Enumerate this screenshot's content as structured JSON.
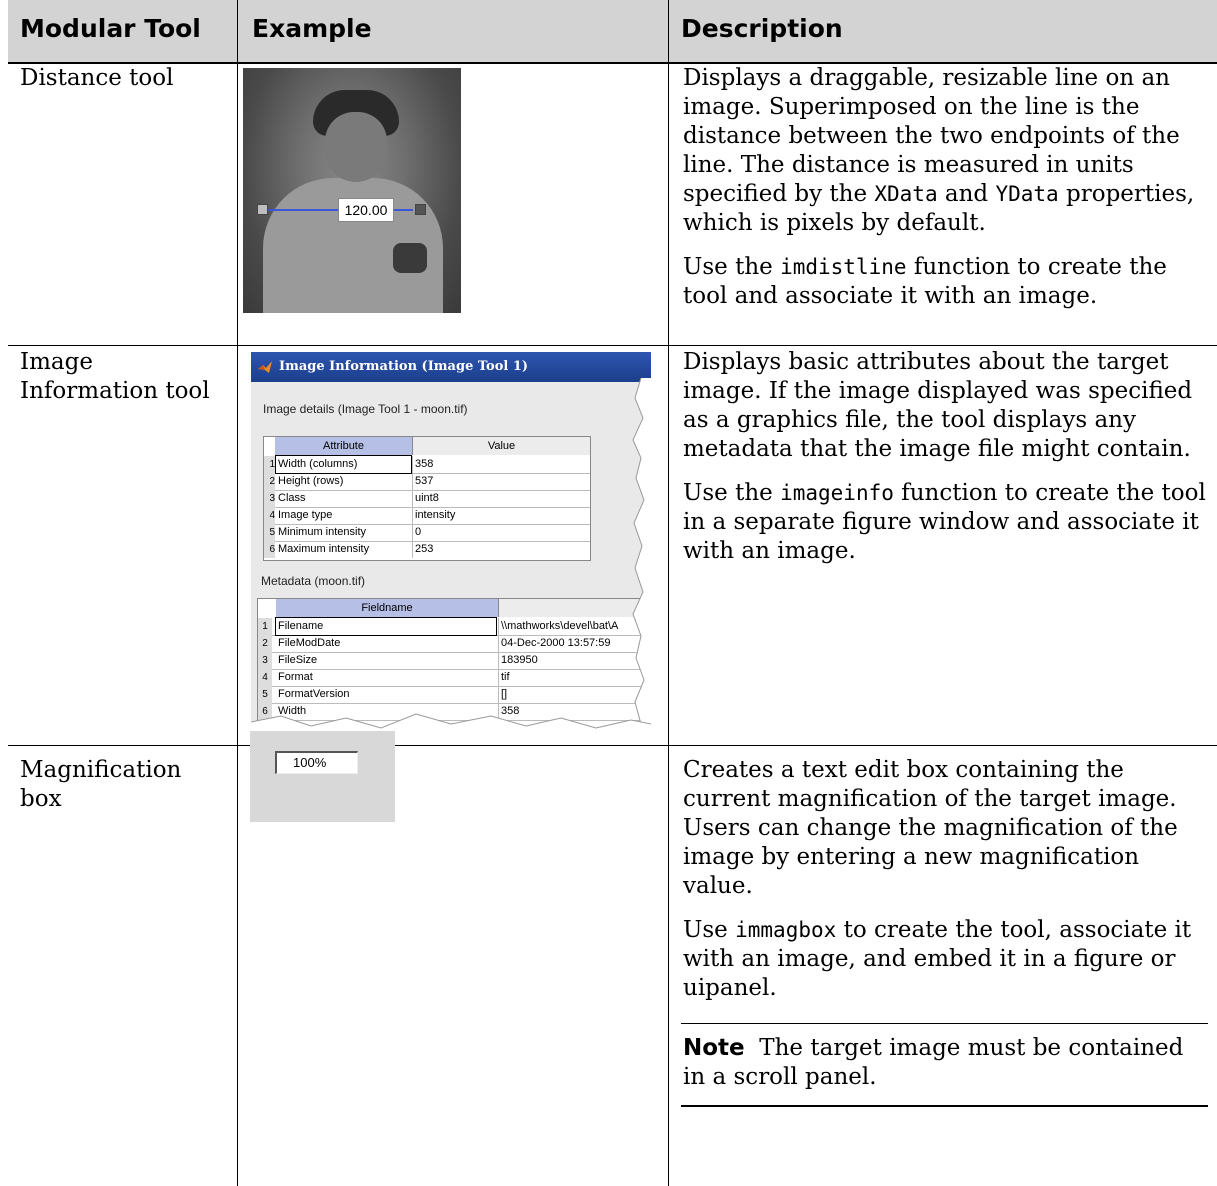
{
  "table": {
    "headers": {
      "tool": "Modular Tool",
      "example": "Example",
      "description": "Description"
    },
    "rows": [
      {
        "tool": "Distance tool",
        "example": {
          "measurement_label": "120.00"
        },
        "desc_1": "Displays a draggable, resizable line on an image. Superimposed on the line is the distance between the two endpoints of the line. The distance is measured in units specified by the",
        "desc_1_code_a": "XData",
        "desc_1_and": "and",
        "desc_1_code_b": "YData",
        "desc_1_end": "properties, which is pixels by default.",
        "desc_2_pre": "Use the",
        "desc_2_code": "imdistline",
        "desc_2_post": "function to create the tool and associate it with an image."
      },
      {
        "tool": "Image Information tool",
        "example": {
          "window_title": "Image Information (Image Tool 1)",
          "details_label": "Image details  (Image Tool 1 - moon.tif)",
          "details_headers": [
            "Attribute",
            "Value"
          ],
          "details_rows": [
            {
              "n": "1",
              "attr": "Width (columns)",
              "value": "358"
            },
            {
              "n": "2",
              "attr": "Height (rows)",
              "value": "537"
            },
            {
              "n": "3",
              "attr": "Class",
              "value": "uint8"
            },
            {
              "n": "4",
              "attr": "Image type",
              "value": "intensity"
            },
            {
              "n": "5",
              "attr": "Minimum intensity",
              "value": "0"
            },
            {
              "n": "6",
              "attr": "Maximum intensity",
              "value": "253"
            }
          ],
          "metadata_label": "Metadata (moon.tif)",
          "metadata_headers": [
            "Fieldname",
            ""
          ],
          "metadata_rows": [
            {
              "n": "1",
              "field": "Filename",
              "value": "\\\\mathworks\\devel\\bat\\A"
            },
            {
              "n": "2",
              "field": "FileModDate",
              "value": "04-Dec-2000 13:57:59"
            },
            {
              "n": "3",
              "field": "FileSize",
              "value": "183950"
            },
            {
              "n": "4",
              "field": "Format",
              "value": "tif"
            },
            {
              "n": "5",
              "field": "FormatVersion",
              "value": "[]"
            },
            {
              "n": "6",
              "field": "Width",
              "value": "358"
            }
          ]
        },
        "desc_1": "Displays basic attributes about the target image. If the image displayed was specified as a graphics file, the tool displays any metadata that the image file might contain.",
        "desc_2_pre": "Use the",
        "desc_2_code": "imageinfo",
        "desc_2_post": "function to create the tool in a separate figure window and associate it with an image."
      },
      {
        "tool": "Magnification box",
        "example": {
          "value": "100%"
        },
        "desc_1": "Creates a text edit box containing the current magnification of the target image. Users can change the magnification of the image by entering a new magnification value.",
        "desc_2_pre": "Use",
        "desc_2_code": "immagbox",
        "desc_2_post": "to create the tool, associate it with an image, and embed it in a figure or uipanel.",
        "note_label": "Note",
        "note_text": "The target image must be contained in a scroll panel."
      }
    ]
  }
}
